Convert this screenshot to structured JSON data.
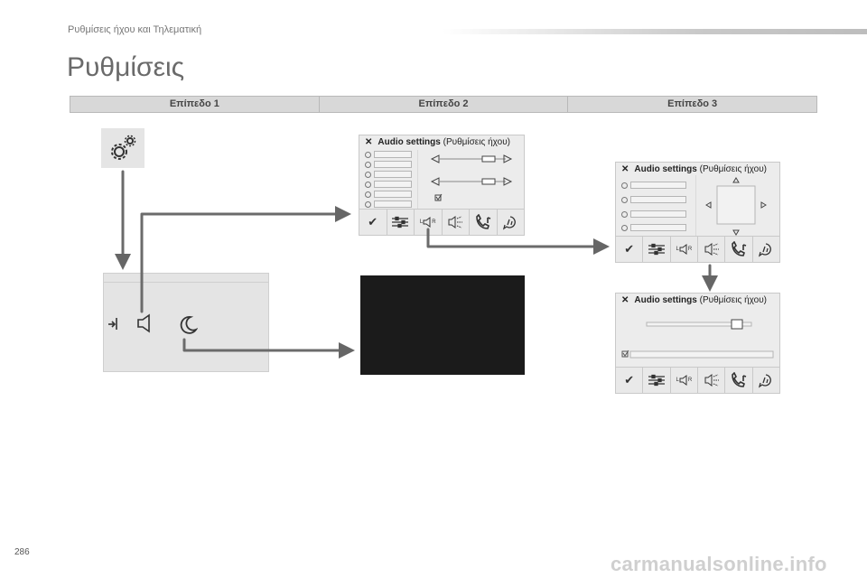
{
  "header": {
    "section": "Ρυθμίσεις ήχου και Τηλεματική"
  },
  "page_title": "Ρυθμίσεις",
  "levels": [
    "Επίπεδο 1",
    "Επίπεδο 2",
    "Επίπεδο 3"
  ],
  "audio_panel": {
    "title_bold": "Audio settings",
    "title_paren": "(Ρυθμίσεις ήχου)"
  },
  "toolbar": {
    "check": "✔",
    "lr_left": "L",
    "lr_right": "R"
  },
  "page_number": "286",
  "watermark": "carmanualsonline.info"
}
